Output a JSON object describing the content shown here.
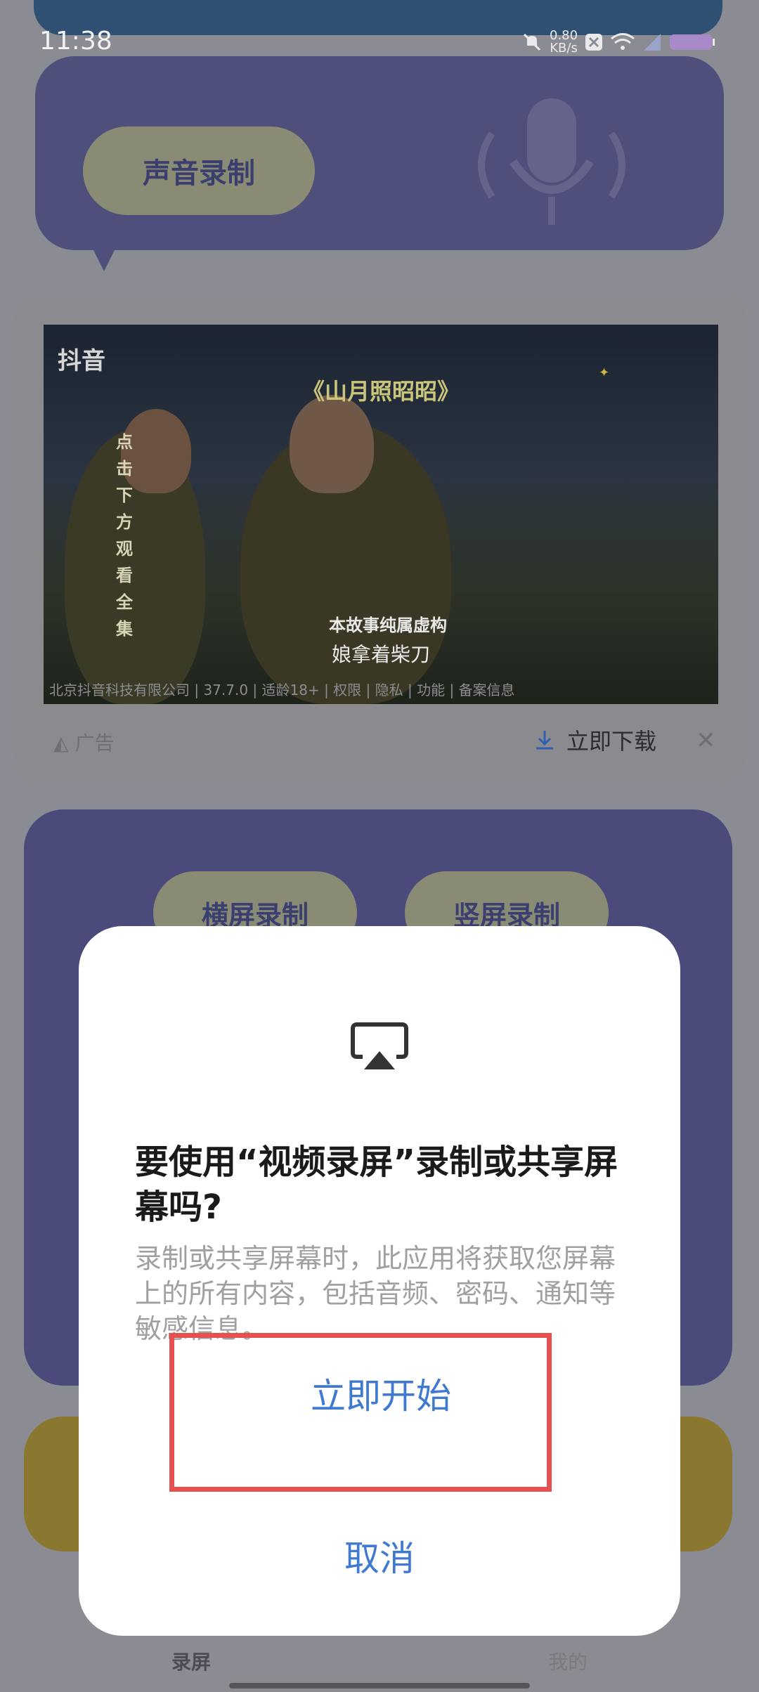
{
  "status_bar": {
    "time": "11:38",
    "speed_value": "0.80",
    "speed_unit": "KB/s"
  },
  "background": {
    "voice_button": "声音录制",
    "ad": {
      "watermark": "抖音",
      "title": "《山月照昭昭》",
      "vertical_text": "点击下方观看全集",
      "caption_small": "本故事纯属虚构",
      "caption": "娘拿着柴刀",
      "company_line": "北京抖音科技有限公司 | 37.7.0 | 适龄18+ | 权限 | 隐私 | 功能 | 备案信息",
      "label": "广告",
      "download": "立即下载"
    },
    "landscape_button": "横屏录制",
    "portrait_button": "竖屏录制",
    "tab_record": "录屏",
    "tab_other": "我的"
  },
  "dialog": {
    "title": "要使用“视频录屏”录制或共享屏幕吗?",
    "body": "录制或共享屏幕时，此应用将获取您屏幕上的所有内容，包括音频、密码、通知等敏感信息。",
    "start_button": "立即开始",
    "cancel_button": "取消"
  },
  "colors": {
    "accent": "#3f79d0",
    "highlight": "#e55050"
  }
}
